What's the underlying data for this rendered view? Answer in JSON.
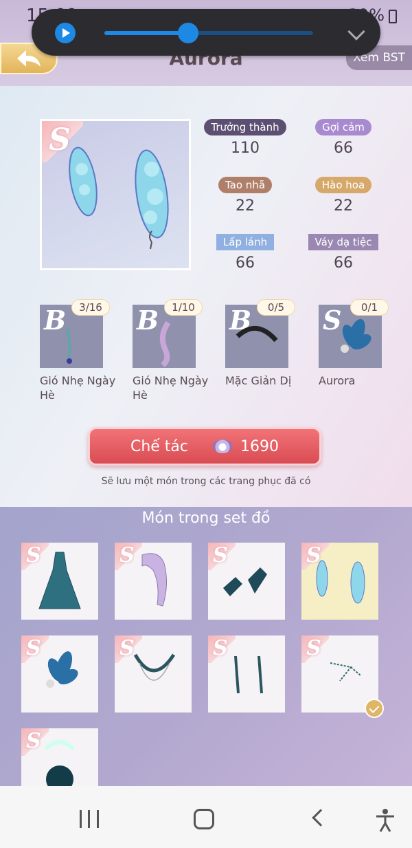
{
  "status": {
    "time": "15:09",
    "battery": "39%"
  },
  "header": {
    "title": "Aurora",
    "view_collection": "Xem BST"
  },
  "media": {
    "progress": 0.4
  },
  "item": {
    "rank": "S",
    "stats": [
      {
        "label": "Trưởng thành",
        "value": "110",
        "color": "#5d4f72"
      },
      {
        "label": "Gợi cảm",
        "value": "66",
        "color": "#a88ad0"
      },
      {
        "label": "Tao nhã",
        "value": "22",
        "color": "#b07f6a"
      },
      {
        "label": "Hào hoa",
        "value": "22",
        "color": "#d6a86a"
      },
      {
        "label": "Lấp lánh",
        "value": "66",
        "color": "#8fb0e0"
      },
      {
        "label": "Váy dạ tiệc",
        "value": "66",
        "color": "#9a88b2"
      }
    ]
  },
  "materials": [
    {
      "rank": "B",
      "count": "3/16",
      "name": "Gió Nhẹ Ngày Hè"
    },
    {
      "rank": "B",
      "count": "1/10",
      "name": "Gió Nhẹ Ngày Hè"
    },
    {
      "rank": "B",
      "count": "0/5",
      "name": "Mặc Giản Dị"
    },
    {
      "rank": "S",
      "count": "0/1",
      "name": "Aurora"
    }
  ],
  "craft": {
    "label": "Chế tác",
    "cost": "1690",
    "note": "Sẽ lưu một món trong các trang phục đã có"
  },
  "set": {
    "title": "Món trong set đồ",
    "items": [
      {
        "rank": "S",
        "icon": "dress-icon",
        "selected": false,
        "owned": false
      },
      {
        "rank": "S",
        "icon": "hair-icon",
        "selected": false,
        "owned": false
      },
      {
        "rank": "S",
        "icon": "shoes-icon",
        "selected": false,
        "owned": false
      },
      {
        "rank": "S",
        "icon": "feather-earrings-icon",
        "selected": true,
        "owned": false
      },
      {
        "rank": "S",
        "icon": "flower-hairpin-icon",
        "selected": false,
        "owned": false
      },
      {
        "rank": "S",
        "icon": "necklace-icon",
        "selected": false,
        "owned": false
      },
      {
        "rank": "S",
        "icon": "drop-earrings-icon",
        "selected": false,
        "owned": false
      },
      {
        "rank": "S",
        "icon": "chain-icon",
        "selected": false,
        "owned": true
      },
      {
        "rank": "S",
        "icon": "pearl-bag-icon",
        "selected": false,
        "owned": false
      }
    ]
  }
}
